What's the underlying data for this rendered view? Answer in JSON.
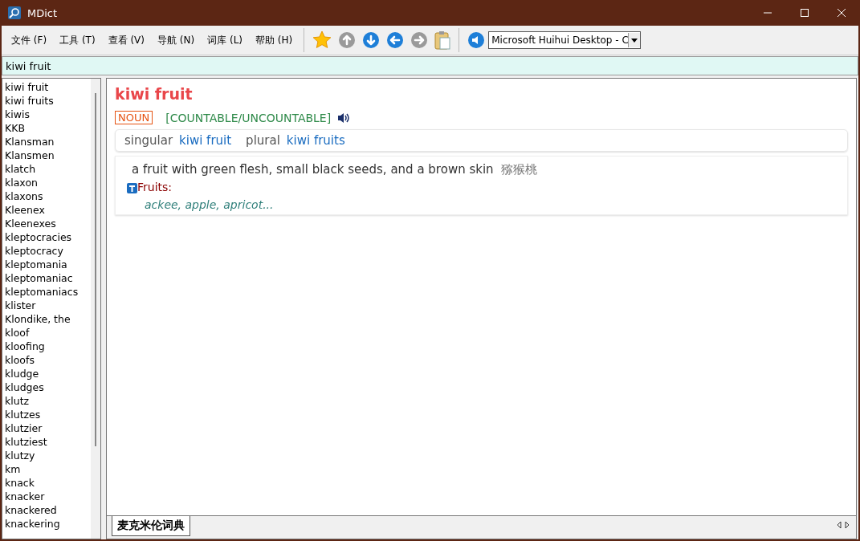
{
  "window": {
    "title": "MDict"
  },
  "menu": [
    "文件 (F)",
    "工具 (T)",
    "查看 (V)",
    "导航 (N)",
    "词库 (L)",
    "帮助 (H)"
  ],
  "font_select": {
    "value": "Microsoft Huihui Desktop - C"
  },
  "search": {
    "value": "kiwi fruit"
  },
  "word_list": [
    "kiwi fruit",
    "kiwi fruits",
    "kiwis",
    "KKB",
    "Klansman",
    "Klansmen",
    "klatch",
    "klaxon",
    "klaxons",
    "Kleenex",
    "Kleenexes",
    "kleptocracies",
    "kleptocracy",
    "kleptomania",
    "kleptomaniac",
    "kleptomaniacs",
    "klister",
    "Klondike, the",
    "kloof",
    "kloofing",
    "kloofs",
    "kludge",
    "kludges",
    "klutz",
    "klutzes",
    "klutzier",
    "klutziest",
    "klutzy",
    "km",
    "knack",
    "knacker",
    "knackered",
    "knackering"
  ],
  "entry": {
    "headword": "kiwi fruit",
    "pos": "NOUN",
    "grammar": "[COUNTABLE/UNCOUNTABLE]",
    "forms": [
      {
        "label": "singular",
        "form": "kiwi fruit"
      },
      {
        "label": "plural",
        "form": "kiwi fruits"
      }
    ],
    "definition": "a fruit with green flesh, small black seeds, and a brown skin",
    "translation": "猕猴桃",
    "thesaurus_title": "Fruits:",
    "thesaurus_words": "ackee, apple, apricot..."
  },
  "dictionary_tabs": [
    {
      "label": "麦克米伦词典",
      "selected": true
    }
  ]
}
